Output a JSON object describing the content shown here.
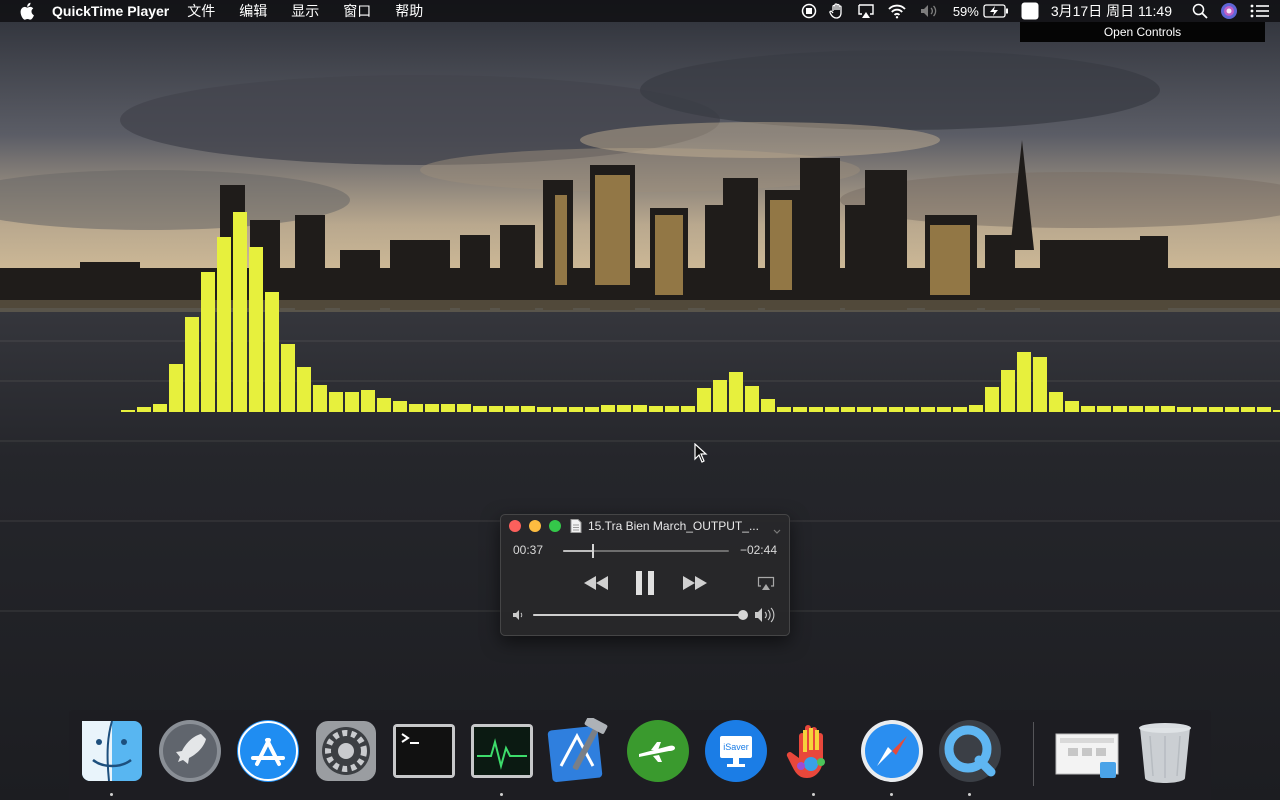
{
  "menubar": {
    "app_name": "QuickTime Player",
    "menus": [
      "文件",
      "编辑",
      "显示",
      "窗口",
      "帮助"
    ],
    "battery_percent": "59%",
    "input_method": "拼",
    "clock": "3月17日 周日 11:49"
  },
  "tooltip": {
    "text": "Open Controls"
  },
  "visualizer": {
    "bar_color": "#e7f03d",
    "levels": [
      2,
      5,
      8,
      48,
      95,
      140,
      175,
      200,
      165,
      120,
      68,
      45,
      27,
      20,
      20,
      22,
      14,
      11,
      8,
      8,
      8,
      8,
      6,
      6,
      6,
      6,
      5,
      5,
      5,
      5,
      7,
      7,
      7,
      6,
      6,
      6,
      24,
      32,
      40,
      26,
      13,
      5,
      5,
      5,
      5,
      5,
      5,
      5,
      5,
      5,
      5,
      5,
      5,
      7,
      25,
      42,
      60,
      55,
      20,
      11,
      6,
      6,
      6,
      6,
      6,
      6,
      5,
      5,
      5,
      5,
      5,
      5,
      2
    ]
  },
  "player": {
    "title": "15.Tra Bien March_OUTPUT_...",
    "elapsed": "00:37",
    "remaining": "−02:44",
    "progress": 0.18,
    "volume": 0.99,
    "state": "playing"
  },
  "dock": {
    "items": [
      {
        "name": "Finder",
        "icon": "finder-icon",
        "running": true
      },
      {
        "name": "Launchpad",
        "icon": "launchpad-icon",
        "running": false
      },
      {
        "name": "App Store",
        "icon": "app-store-icon",
        "running": false
      },
      {
        "name": "System Preferences",
        "icon": "system-preferences-icon",
        "running": false
      },
      {
        "name": "Terminal",
        "icon": "terminal-icon",
        "running": false
      },
      {
        "name": "Activity Monitor",
        "icon": "activity-monitor-icon",
        "running": true
      },
      {
        "name": "Xcode",
        "icon": "xcode-icon",
        "running": false
      },
      {
        "name": "Airplane App",
        "icon": "airplane-icon",
        "running": false
      },
      {
        "name": "iSaver",
        "icon": "isaver-icon",
        "running": false,
        "label": "iSaver"
      },
      {
        "name": "Colorful Hand App",
        "icon": "hand-icon",
        "running": true
      },
      {
        "name": "Safari",
        "icon": "safari-icon",
        "running": true
      },
      {
        "name": "QuickTime Player",
        "icon": "quicktime-icon",
        "running": true
      },
      {
        "name": "Downloads Stack",
        "icon": "stack-icon",
        "running": false
      },
      {
        "name": "Trash",
        "icon": "trash-icon",
        "running": false
      }
    ]
  }
}
